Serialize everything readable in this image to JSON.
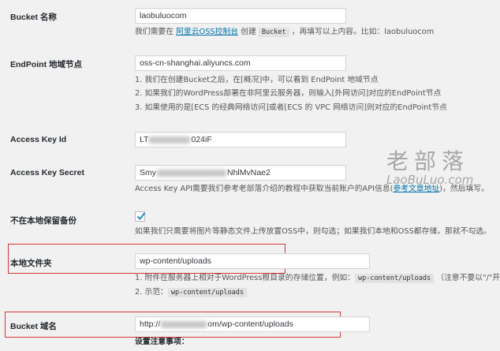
{
  "bucket": {
    "label": "Bucket 名称",
    "value": "laobuluocom",
    "desc_prefix": "我们需要在 ",
    "desc_link": "阿里云OSS控制台",
    "desc_mid": " 创建 ",
    "desc_code": "Bucket",
    "desc_suffix": " ，再填写以上内容。比如：laobuluocom"
  },
  "endpoint": {
    "label": "EndPoint 地域节点",
    "value": "oss-cn-shanghai.aliyuncs.com",
    "desc1": "1. 我们在创建Bucket之后，在[概况]中，可以看到 EndPoint 地域节点",
    "desc2": "2. 如果我们的WordPress部署在非阿里云服务器，则输入[外网访问]对应的EndPoint节点",
    "desc3": "3. 如果使用的是[ECS 的经典网络访问]或者[ECS 的 VPC 网络访问]则对应的EndPoint节点"
  },
  "access_key_id": {
    "label": "Access Key Id",
    "value_start": "LT",
    "value_end": "024iF"
  },
  "access_key_secret": {
    "label": "Access Key Secret",
    "value_start": "Smy",
    "value_end": "NhlMvNae2",
    "desc_prefix": "Access Key API需要我们参考老部落介绍的教程中获取当前账户的API信息(",
    "desc_link": "参考文章地址",
    "desc_suffix": ")，然后填写。"
  },
  "keep_local": {
    "label": "不在本地保留备份",
    "checked": true,
    "desc": "如果我们只需要将图片等静态文件上传放置OSS中，则勾选；如果我们本地和OSS都存储，那就不勾选。"
  },
  "local_folder": {
    "label": "本地文件夹",
    "value": "wp-content/uploads",
    "desc1_prefix": "1. 附件在服务器上相对于WordPress根目录的存储位置，例如：",
    "desc1_code": "wp-content/uploads",
    "desc1_suffix": " （注意不要以\"/\"开",
    "desc2_prefix": "2. 示范：",
    "desc2_code": "wp-content/uploads"
  },
  "bucket_domain": {
    "label": "Bucket 域名",
    "value_start": "http://",
    "value_end": "om/wp-content/uploads"
  },
  "settings_notes": {
    "label": "设置注意事项："
  },
  "watermark": {
    "cn": "老部落",
    "en": "LaoBuLuo.com"
  },
  "colors": {
    "link": "#0073aa",
    "highlight_border": "#d63638",
    "background": "#f1f1f1"
  }
}
